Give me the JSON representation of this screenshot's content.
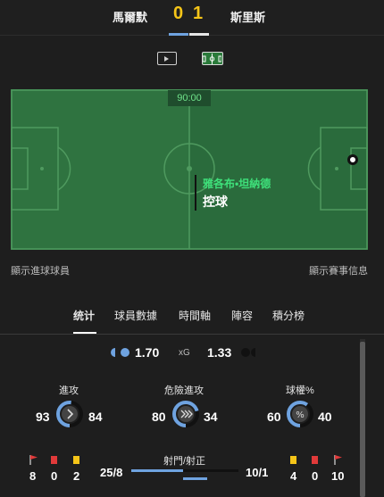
{
  "match": {
    "home_team": "馬爾默",
    "away_team": "斯里斯",
    "home_score": "0",
    "away_score": "1"
  },
  "view_toggle": {
    "options": [
      "video",
      "pitch"
    ],
    "active": "pitch"
  },
  "pitch": {
    "clock": "90:00",
    "possession_player": "雅各布•坦納德",
    "possession_action": "控球"
  },
  "pitch_links": {
    "left": "顯示進球球員",
    "right": "顯示賽事信息"
  },
  "tabs": [
    {
      "label": "统计",
      "active": true
    },
    {
      "label": "球員數據",
      "active": false
    },
    {
      "label": "時間軸",
      "active": false
    },
    {
      "label": "陣容",
      "active": false
    },
    {
      "label": "積分榜",
      "active": false
    }
  ],
  "xg": {
    "label": "xG",
    "home": "1.70",
    "away": "1.33"
  },
  "stats": [
    {
      "title": "進攻",
      "home": "93",
      "away": "84",
      "icon": "chevron-right-icon"
    },
    {
      "title": "危險進攻",
      "home": "80",
      "away": "34",
      "icon": "double-chevron-icon"
    },
    {
      "title": "球權%",
      "home": "60",
      "away": "40",
      "icon": "percent-icon"
    }
  ],
  "events": {
    "home": {
      "corners": "8",
      "red_cards": "0",
      "yellow_cards": "2"
    },
    "away": {
      "yellow_cards": "4",
      "red_cards": "0",
      "corners": "10"
    }
  },
  "shots": {
    "title": "射門/射正",
    "home": "25/8",
    "away": "10/1"
  },
  "colors": {
    "home": "#6fa3e0",
    "away": "#e6e6e6",
    "score": "#f5c518",
    "pitch": "#2b6a3a",
    "possession_text": "#3ee07a"
  }
}
